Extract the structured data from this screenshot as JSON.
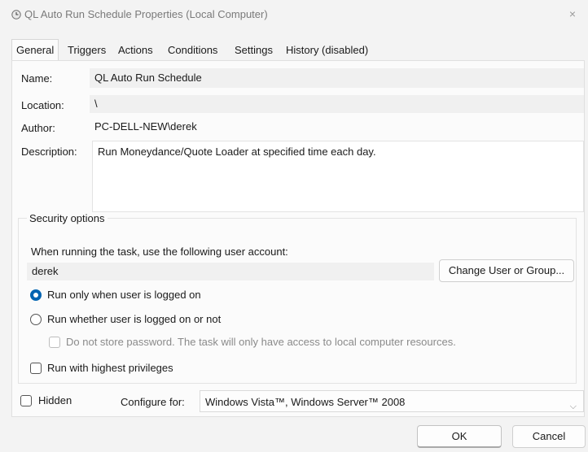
{
  "window": {
    "title": "QL Auto Run Schedule Properties (Local Computer)",
    "close_glyph": "×"
  },
  "tabs": [
    {
      "label": "General",
      "active": true
    },
    {
      "label": "Triggers"
    },
    {
      "label": "Actions"
    },
    {
      "label": "Conditions"
    },
    {
      "label": "Settings"
    },
    {
      "label": "History (disabled)"
    }
  ],
  "general": {
    "name_label": "Name:",
    "name_value": "QL Auto Run Schedule",
    "location_label": "Location:",
    "location_value": "\\",
    "author_label": "Author:",
    "author_value": "PC-DELL-NEW\\derek",
    "description_label": "Description:",
    "description_value": "Run Moneydance/Quote Loader at specified time each day."
  },
  "security": {
    "group_title": "Security options",
    "account_prompt": "When running the task, use the following user account:",
    "account_value": "derek",
    "change_user_button": "Change User or Group...",
    "radio_logged_on": "Run only when user is logged on",
    "radio_logged_on_checked": true,
    "radio_whether": "Run whether user is logged on or not",
    "radio_whether_checked": false,
    "no_store_password": "Do not store password.  The task will only have access to local computer resources.",
    "highest_privileges": "Run with highest privileges"
  },
  "bottom": {
    "hidden_label": "Hidden",
    "configure_label": "Configure for:",
    "configure_value": "Windows Vista™, Windows Server™ 2008"
  },
  "buttons": {
    "ok": "OK",
    "cancel": "Cancel"
  },
  "colors": {
    "accent": "#0063b1",
    "window_bg": "#f3f3f3",
    "panel_bg": "#fbfbfb"
  }
}
